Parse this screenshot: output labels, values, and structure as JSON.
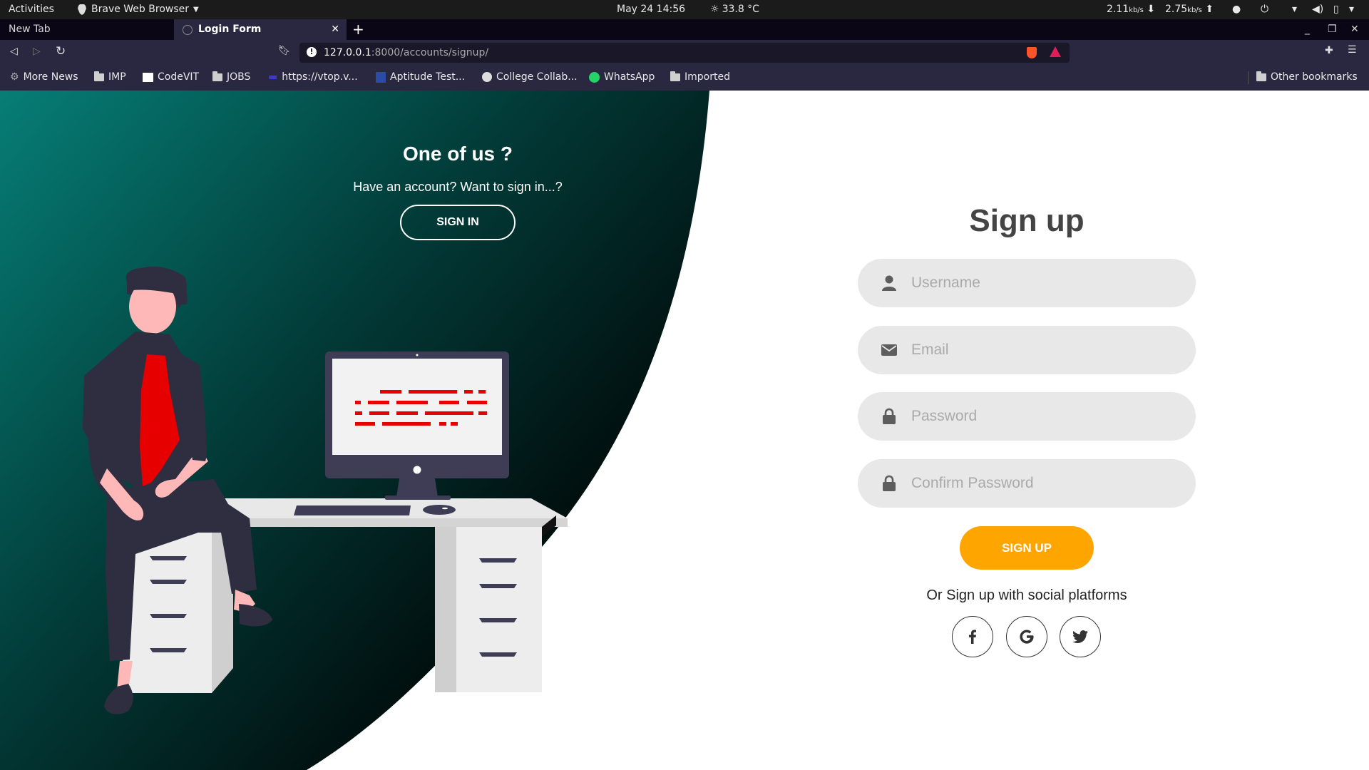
{
  "system_bar": {
    "activities": "Activities",
    "app_name": "Brave Web Browser",
    "datetime": "May 24  14:56",
    "temperature": "33.8 °C",
    "down_speed": "2.11",
    "down_unit": "kb/s",
    "up_speed": "2.75",
    "up_unit": "kb/s"
  },
  "tabs": [
    {
      "title": "New Tab"
    },
    {
      "title": "Login Form"
    }
  ],
  "address_bar": {
    "url_host": "127.0.0.1",
    "url_rest": ":8000/accounts/signup/"
  },
  "bookmarks": {
    "items": [
      "More News",
      "IMP",
      "CodeVIT",
      "JOBS",
      "https://vtop.v...",
      "Aptitude Test...",
      "College Collab...",
      "WhatsApp",
      "Imported"
    ],
    "other": "Other bookmarks"
  },
  "left_panel": {
    "heading": "One of us ?",
    "subtext": "Have an account? Want to sign in...?",
    "button": "SIGN IN"
  },
  "signup_form": {
    "title": "Sign up",
    "username_placeholder": "Username",
    "email_placeholder": "Email",
    "password_placeholder": "Password",
    "confirm_placeholder": "Confirm Password",
    "button": "SIGN UP",
    "social_text": "Or Sign up with social platforms"
  },
  "colors": {
    "accent": "#fea500",
    "panel_teal": "#067e76",
    "panel_dark": "#000000",
    "field_bg": "#e8e8e8",
    "shirt_red": "#e60000"
  }
}
